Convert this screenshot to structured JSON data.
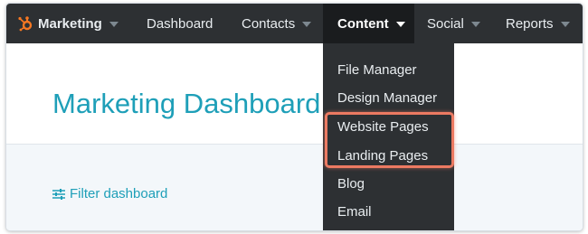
{
  "nav": {
    "brand_label": "Marketing",
    "items": [
      {
        "label": "Dashboard"
      },
      {
        "label": "Contacts"
      },
      {
        "label": "Content"
      },
      {
        "label": "Social"
      },
      {
        "label": "Reports"
      }
    ],
    "background_color": "#2d3033",
    "active_item": "Content"
  },
  "dropdown": {
    "items": [
      {
        "label": "File Manager"
      },
      {
        "label": "Design Manager"
      },
      {
        "label": "Website Pages"
      },
      {
        "label": "Landing Pages"
      },
      {
        "label": "Blog"
      },
      {
        "label": "Email"
      }
    ],
    "highlight_color": "#ec7a62"
  },
  "page": {
    "title": "Marketing Dashboard",
    "filter_label": "Filter dashboard",
    "accent_color": "#1e9fb8"
  },
  "icons": {
    "logo": "hubspot-sprocket-icon",
    "filter": "sliders-icon",
    "dropdown": "caret-down-icon"
  }
}
